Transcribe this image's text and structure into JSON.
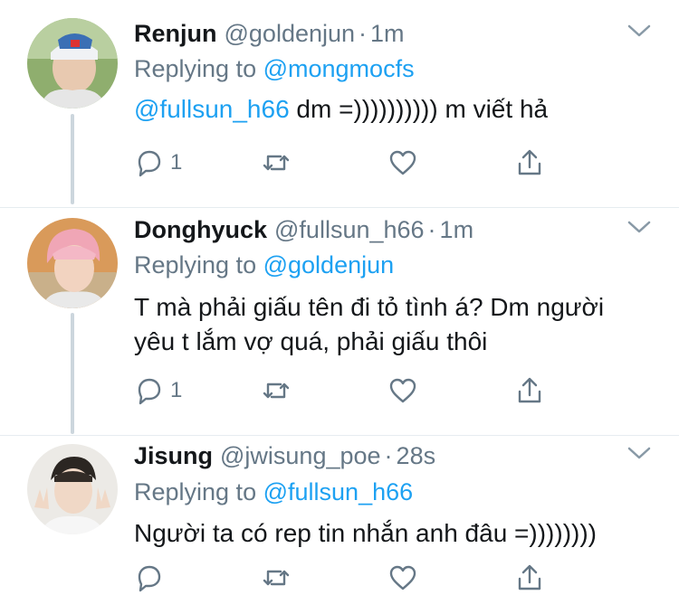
{
  "tweets": [
    {
      "display_name": "Renjun",
      "handle": "@goldenjun",
      "dot": "·",
      "time": "1m",
      "replying_prefix": "Replying to",
      "replying_to": "@mongmocfs",
      "body_mention": "@fullsun_h66",
      "body_text": " dm =)))))))))) m viết hả",
      "reply_count": "1",
      "avatar_icon": "avatar-photo"
    },
    {
      "display_name": "Donghyuck",
      "handle": "@fullsun_h66",
      "dot": "·",
      "time": "1m",
      "replying_prefix": "Replying to",
      "replying_to": "@goldenjun",
      "body_mention": "",
      "body_text": "T mà phải giấu tên đi tỏ tình á? Dm người yêu t lắm vợ quá, phải giấu thôi",
      "reply_count": "1",
      "avatar_icon": "avatar-photo"
    },
    {
      "display_name": "Jisung",
      "handle": "@jwisung_poe",
      "dot": "·",
      "time": "28s",
      "replying_prefix": "Replying to",
      "replying_to": "@fullsun_h66",
      "body_mention": "",
      "body_text": "Người ta có rep tin nhắn anh đâu =))))))))",
      "reply_count": "",
      "avatar_icon": "avatar-photo"
    }
  ],
  "action_icons": [
    "reply-icon",
    "retweet-icon",
    "like-icon",
    "share-icon"
  ],
  "colors": {
    "text": "#14171a",
    "secondary": "#657786",
    "mention": "#1da1f2",
    "thread_line": "#ccd6dd"
  }
}
